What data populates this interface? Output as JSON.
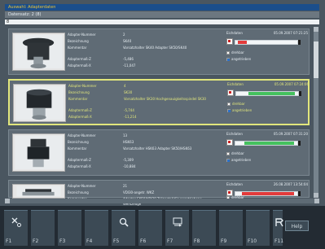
{
  "window": {
    "title": "Auswahl: Adapterdaten",
    "subtitle": "Datensatz: 2 (8)",
    "filter_value": "8"
  },
  "items": [
    {
      "fields": [
        {
          "label": "Adapter-Nummer",
          "value": "2"
        },
        {
          "label": "Bezeichnung",
          "value": "SK40"
        },
        {
          "label": "Kommentar",
          "value": "Vorsatzhalter SK40\nAdapter SK50/SK40"
        },
        {
          "label": "Adaptermaß-Z",
          "value": "-5,486"
        },
        {
          "label": "Adaptermaß-X",
          "value": "-11,047"
        }
      ],
      "panel": {
        "title": "Eichdaten",
        "date": "05.09.2007 07:21:25",
        "meter_fill_pct": [
          0.05,
          0.2,
          0.95
        ],
        "meter_colors": [
          "#e33b3b",
          "#e33b3b"
        ],
        "drehbar": "drehbar",
        "angetrieben": "angetrieben"
      }
    },
    {
      "fields": [
        {
          "label": "Adapter-Nummer",
          "value": "4"
        },
        {
          "label": "Bezeichnung",
          "value": "SK30"
        },
        {
          "label": "Kommentar",
          "value": "Vorsatzhalter SK30\nHochgenauigkeitsspindel SK30"
        },
        {
          "label": "Adaptermaß-Z",
          "value": "-5,744"
        },
        {
          "label": "Adaptermaß-X",
          "value": "-11,214"
        }
      ],
      "panel": {
        "title": "Eichdaten",
        "date": "05.09.2007 07:24:06",
        "meter_fill_pct": [
          0.2,
          0.95
        ],
        "meter_colors": [
          "#45c15e"
        ],
        "drehbar": "drehbar",
        "angetrieben": "angetrieben"
      }
    },
    {
      "fields": [
        {
          "label": "Adapter-Nummer",
          "value": "13"
        },
        {
          "label": "Bezeichnung",
          "value": "HSK63"
        },
        {
          "label": "Kommentar",
          "value": "Vorsatzhalter HSK63\nAdapter SK50/HSK63"
        },
        {
          "label": "Adaptermaß-Z",
          "value": "-5,309"
        },
        {
          "label": "Adaptermaß-X",
          "value": "-10,884"
        }
      ],
      "panel": {
        "title": "Eichdaten",
        "date": "05.09.2007 07:31:20",
        "meter_fill_pct": [
          0.15,
          0.95
        ],
        "meter_colors": [
          "#45c15e"
        ],
        "drehbar": "drehbar",
        "angetrieben": "angetrieben"
      }
    },
    {
      "fields": [
        {
          "label": "Adapter-Nummer",
          "value": "21"
        },
        {
          "label": "Bezeichnung",
          "value": "VDI30-angetr. WKZ"
        },
        {
          "label": "Kommentar",
          "value": "Adapter SK50/VDI30\nTeilgestell für angetriebene Werkzeuge"
        }
      ],
      "panel": {
        "title": "Eichdaten",
        "date": "26.08.2007 13:54:04",
        "meter_fill_pct": [
          0.1,
          0.95
        ],
        "meter_colors": [
          "#e33b3b"
        ],
        "drehbar": "drehbar"
      }
    }
  ],
  "fkeys": [
    {
      "label": "F1",
      "icon": "scissors-hand-icon"
    },
    {
      "label": "F2",
      "icon": ""
    },
    {
      "label": "F3",
      "icon": ""
    },
    {
      "label": "F4",
      "icon": ""
    },
    {
      "label": "F5",
      "icon": "search-hand-icon"
    },
    {
      "label": "F6",
      "icon": ""
    },
    {
      "label": "F7",
      "icon": "compare-icon"
    },
    {
      "label": "F8",
      "icon": ""
    },
    {
      "label": "F9",
      "icon": ""
    },
    {
      "label": "F10",
      "icon": ""
    },
    {
      "label": "F11",
      "icon": "undo-r-icon"
    }
  ],
  "help_label": "Help"
}
